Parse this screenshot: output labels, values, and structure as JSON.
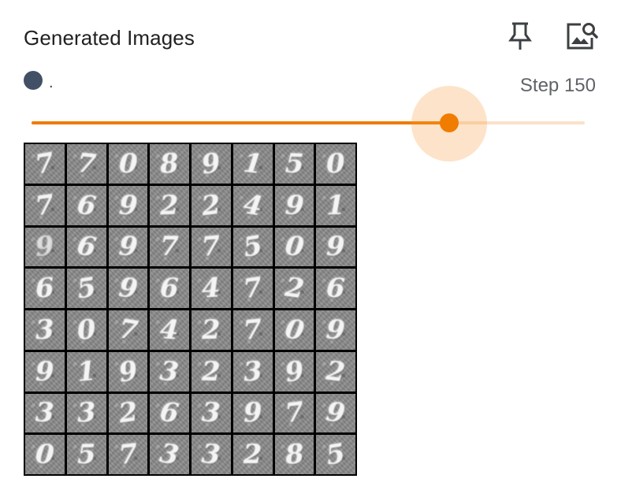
{
  "panel": {
    "title": "Generated Images",
    "run_name": ".",
    "run_color": "#425066",
    "step_label": "Step 150",
    "pin_icon": "pin-icon",
    "image_icon": "image-search-icon"
  },
  "slider": {
    "value_fraction": 0.755,
    "accent": "#f07c00"
  },
  "image_grid": {
    "rows": 8,
    "cols": 8,
    "digits": [
      "7",
      "7",
      "0",
      "8",
      "9",
      "1",
      "5",
      "0",
      "7",
      "6",
      "9",
      "2",
      "2",
      "4",
      "9",
      "1",
      "9",
      "6",
      "9",
      "7",
      "7",
      "5",
      "0",
      "9",
      "6",
      "5",
      "9",
      "6",
      "4",
      "7",
      "2",
      "6",
      "3",
      "0",
      "7",
      "4",
      "2",
      "7",
      "0",
      "9",
      "9",
      "1",
      "9",
      "3",
      "2",
      "3",
      "9",
      "2",
      "3",
      "3",
      "2",
      "6",
      "3",
      "9",
      "7",
      "9",
      "0",
      "5",
      "7",
      "3",
      "3",
      "2",
      "8",
      "5"
    ]
  }
}
